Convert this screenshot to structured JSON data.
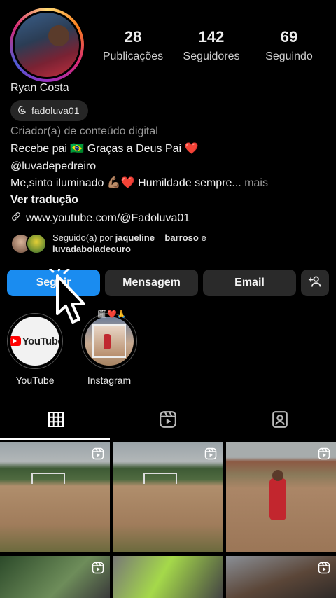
{
  "profile": {
    "name": "Ryan Costa",
    "threads_handle": "fadoluva01",
    "category": "Criador(a) de conteúdo digital",
    "bio_line1": "Recebe pai 🇧🇷 Graças a Deus Pai ❤️",
    "bio_line2": "@luvadepedreiro",
    "bio_line3": "Me,sinto iluminado 💪🏽❤️ Humildade sempre...",
    "more_label": "mais",
    "translate_label": "Ver tradução",
    "link": "www.youtube.com/@Fadoluva01"
  },
  "stats": {
    "posts_count": "28",
    "posts_label": "Publicações",
    "followers_count": "142",
    "followers_label": "Seguidores",
    "following_count": "69",
    "following_label": "Seguindo"
  },
  "followed_by": {
    "prefix": "Seguido(a) por ",
    "user1": "jaqueline__barroso",
    "connector": " e",
    "user2": "luvadaboladeouro"
  },
  "actions": {
    "follow": "Seguir",
    "message": "Mensagem",
    "email": "Email"
  },
  "highlights": [
    {
      "label": "YouTube",
      "logo_text": "YouTube"
    },
    {
      "label": "Instagram",
      "emoji": "🗓❤️🙏"
    }
  ],
  "tabs": [
    "grid-icon",
    "reels-icon",
    "tagged-icon"
  ],
  "colors": {
    "primary_button": "#1a8cf0",
    "button": "#2a2a2a",
    "background": "#000000"
  }
}
